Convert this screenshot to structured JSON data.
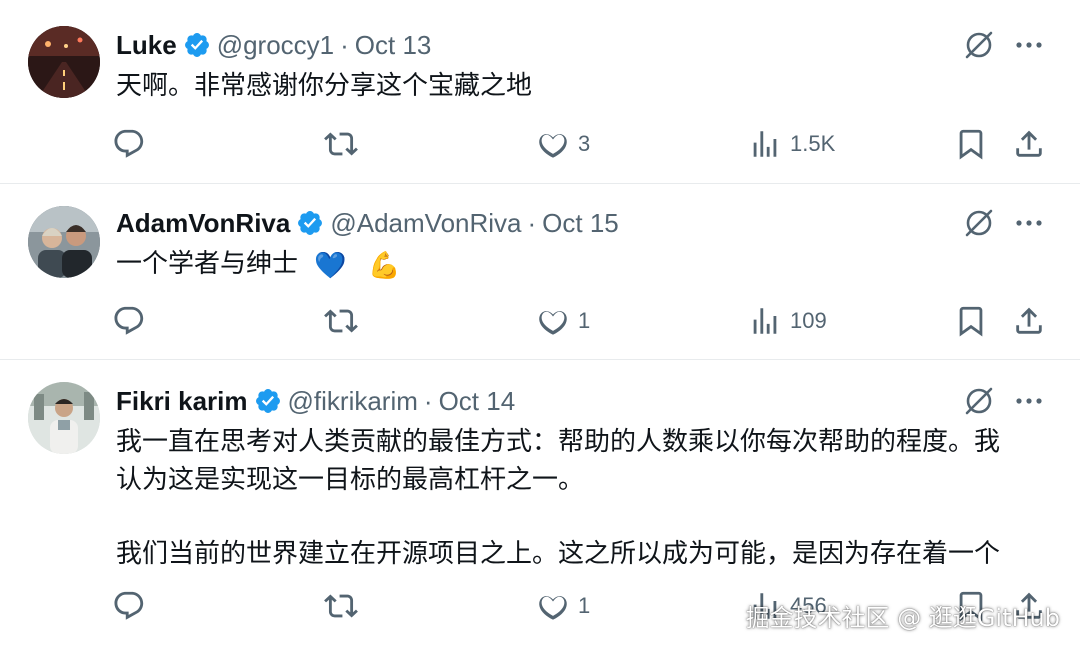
{
  "tweets": [
    {
      "name": "Luke",
      "handle": "@groccy1",
      "separator": "·",
      "time": "Oct 13",
      "text": "天啊。非常感谢你分享这个宝藏之地",
      "likes": "3",
      "views": "1.5K",
      "avatar_icon": "night-road-photo"
    },
    {
      "name": "AdamVonRiva",
      "handle": "@AdamVonRiva",
      "separator": "·",
      "time": "Oct 15",
      "text": "一个学者与绅士",
      "emoji_heart": "💙",
      "emoji_muscle": "💪",
      "likes": "1",
      "views": "109",
      "avatar_icon": "two-people-photo"
    },
    {
      "name": "Fikri karim",
      "handle": "@fikrikarim",
      "separator": "·",
      "time": "Oct 14",
      "text_line1": "我一直在思考对人类贡献的最佳方式：帮助的人数乘以你每次帮助的程度。我",
      "text_line2": "认为这是实现这一目标的最高杠杆之一。",
      "text_line3": "我们当前的世界建立在开源项目之上。这之所以成为可能，是因为存在着一个",
      "likes": "1",
      "views": "456",
      "avatar_icon": "person-portrait-photo"
    }
  ],
  "watermark": "掘金技术社区 @ 逛逛GitHub",
  "colors": {
    "text": "#0f1419",
    "secondary": "#536471",
    "verified": "#1d9bf0",
    "divider": "#e8ebed"
  }
}
